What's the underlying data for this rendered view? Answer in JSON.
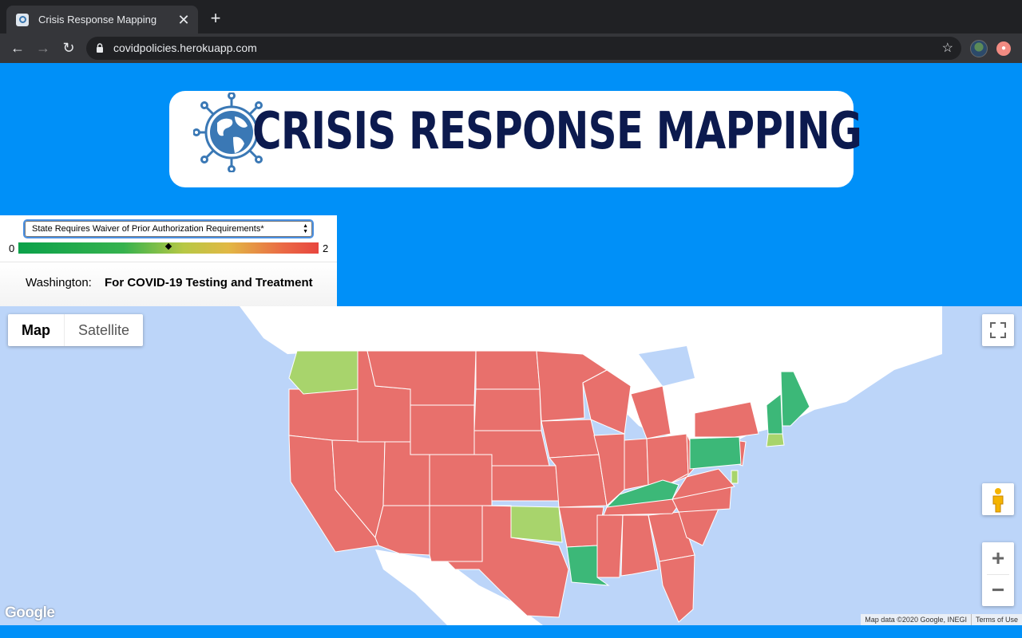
{
  "browser": {
    "tab_title": "Crisis Response Mapping",
    "tab_close": "✕",
    "new_tab": "+",
    "url": "covidpolicies.herokuapp.com",
    "back": "←",
    "forward": "→",
    "reload": "↻",
    "star": "☆"
  },
  "header": {
    "logo_text": "CRISIS RESPONSE MAPPING"
  },
  "controls": {
    "selected_policy": "State Requires Waiver of Prior Authorization Requirements*",
    "scale_min": "0",
    "scale_max": "2",
    "scale_marker_fraction": 0.5,
    "scale_colors": [
      "#0ba14a",
      "#b7c845",
      "#e8463f"
    ]
  },
  "info": {
    "state": "Washington:",
    "value": "For COVID-19 Testing and Treatment"
  },
  "map": {
    "type_buttons": [
      "Map",
      "Satellite"
    ],
    "active_type": "Map",
    "zoom_in": "+",
    "zoom_out": "−",
    "google_logo": "Google",
    "attribution": "Map data ©2020 Google, INEGI",
    "terms": "Terms of Use",
    "colors": {
      "red": "#e8706c",
      "green": "#3cb878",
      "light_green": "#a8d46c",
      "water": "#bcd5f9",
      "land": "#ffffff"
    },
    "states_green": [
      "Pennsylvania",
      "Kentucky",
      "Louisiana",
      "Maine",
      "New Hampshire"
    ],
    "states_light_green": [
      "Washington",
      "Oklahoma",
      "Massachusetts",
      "Delaware"
    ]
  }
}
